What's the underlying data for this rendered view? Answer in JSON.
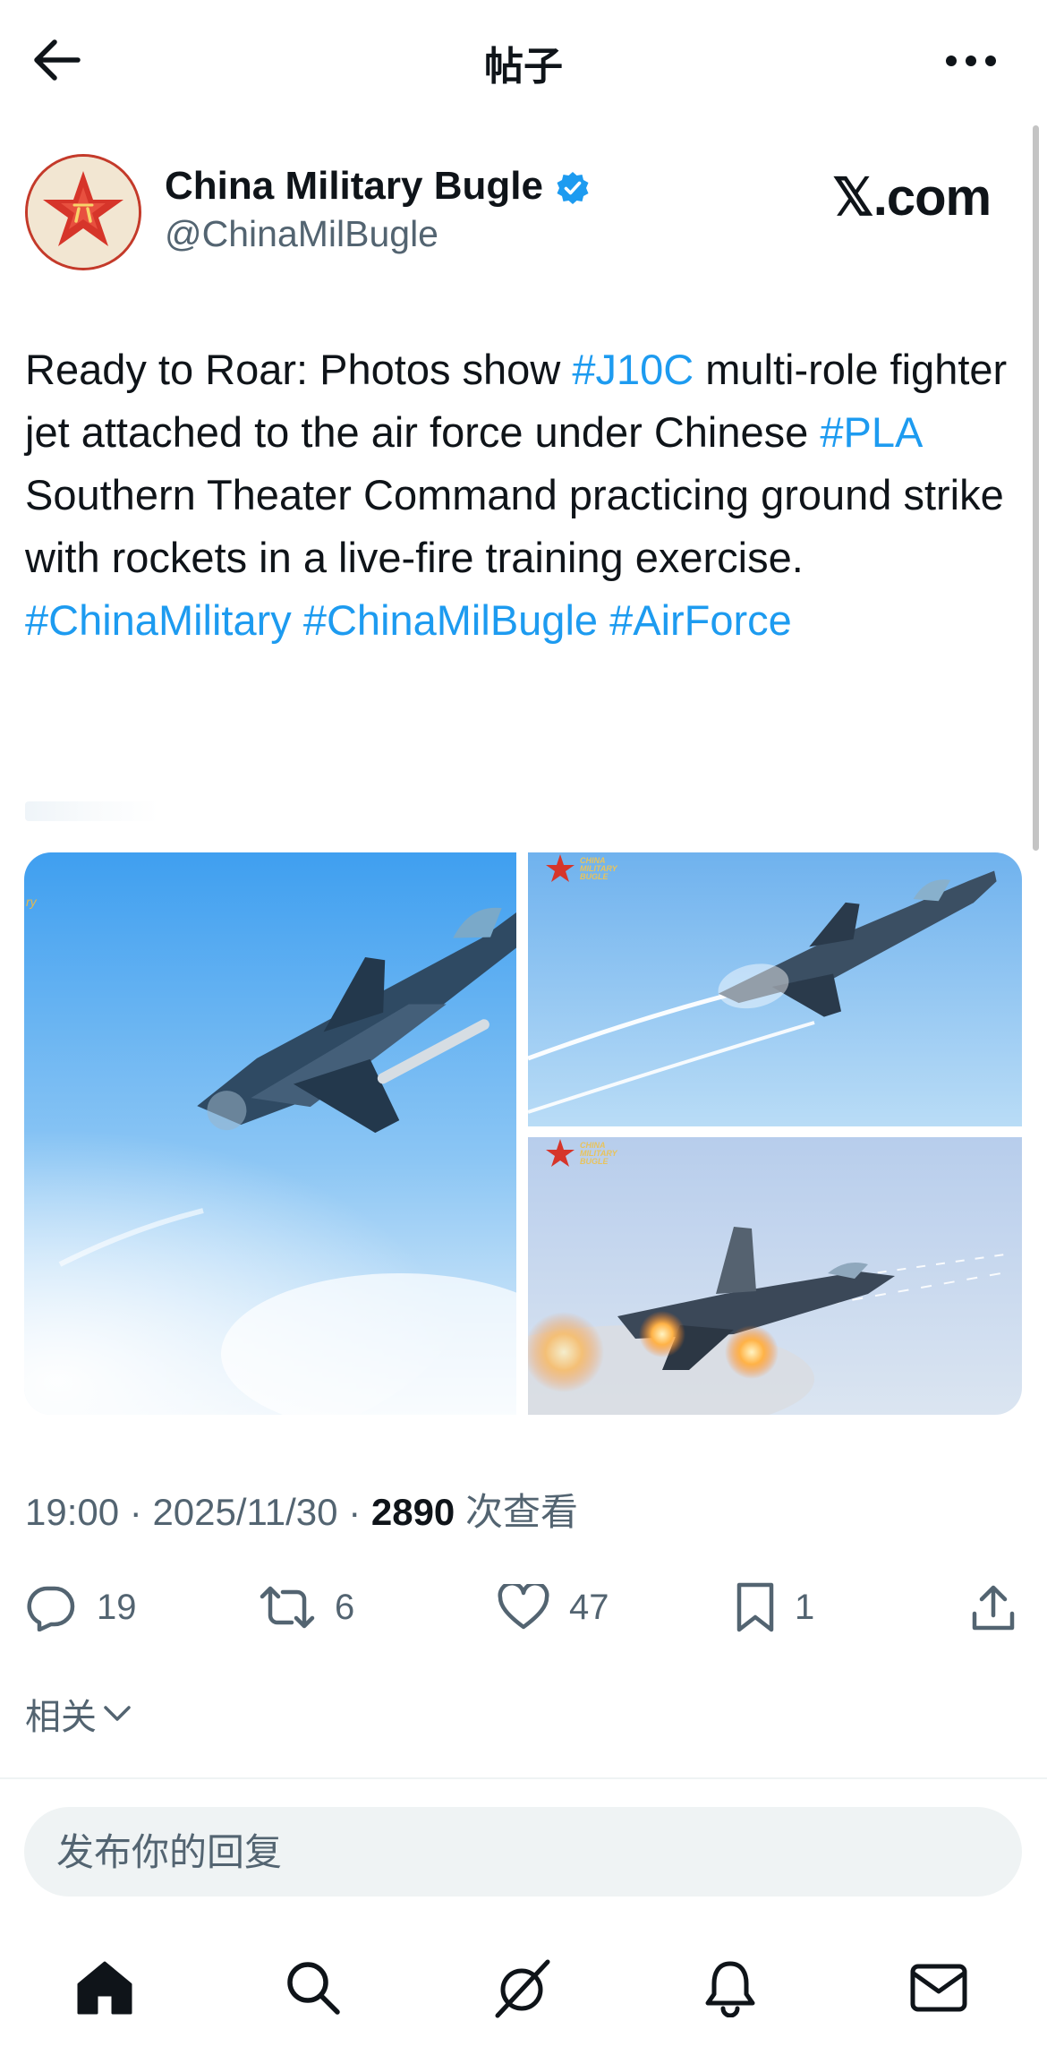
{
  "header": {
    "title": "帖子",
    "back_icon": "arrow-left-icon",
    "more_icon": "more-horizontal-icon"
  },
  "post": {
    "author_name": "China Military Bugle",
    "handle": "@ChinaMilBugle",
    "verified": true,
    "watermark": "𝕏.com",
    "text_segments": [
      {
        "text": "Ready to Roar: Photos show ",
        "tag": false
      },
      {
        "text": "#J10C",
        "tag": true
      },
      {
        "text": " multi-role fighter jet attached to the air force under Chinese ",
        "tag": false
      },
      {
        "text": "#PLA",
        "tag": true
      },
      {
        "text": " Southern Theater Command practicing ground strike with rockets  in a live-fire training exercise.",
        "tag": false
      }
    ],
    "hashtags": [
      "#ChinaMilitary",
      "#ChinaMilBugle",
      "#AirForce"
    ],
    "image_watermark": "CHINA MILITARY BUGLE",
    "time": "19:00",
    "date": "2025/11/30",
    "views": "2890",
    "views_label": "次查看",
    "separator": " · "
  },
  "actions": {
    "replies": "19",
    "reposts": "6",
    "likes": "47",
    "bookmarks": "1"
  },
  "related_label": "相关",
  "reply_placeholder": "发布你的回复",
  "nav": [
    "home-icon",
    "search-icon",
    "grok-icon",
    "notifications-icon",
    "messages-icon"
  ],
  "colors": {
    "accent": "#1d9bf0",
    "text": "#0f1419",
    "secondary": "#536471",
    "badge_red": "#d6352a"
  }
}
